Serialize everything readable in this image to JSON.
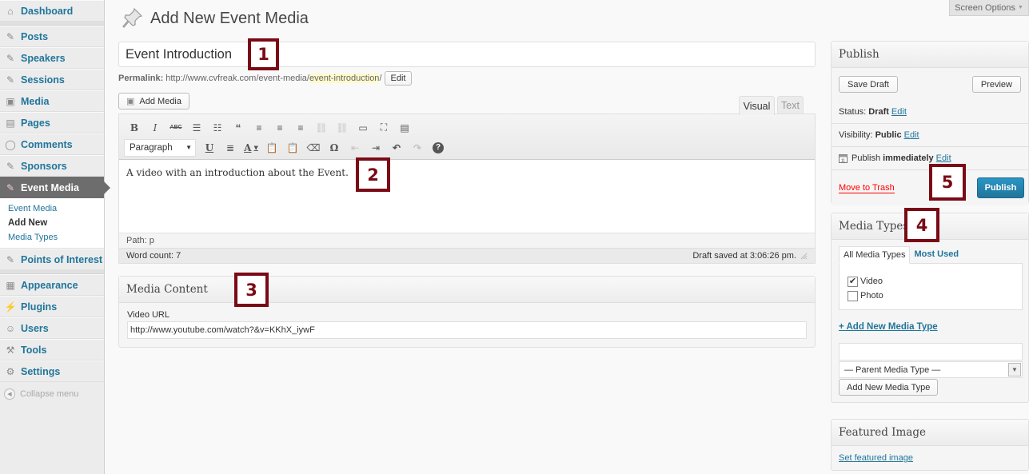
{
  "sidebar": {
    "items": [
      {
        "label": "Dashboard",
        "icon": "dashboard-icon"
      },
      {
        "label": "Posts",
        "icon": "pin-icon"
      },
      {
        "label": "Speakers",
        "icon": "pin-icon"
      },
      {
        "label": "Sessions",
        "icon": "pin-icon"
      },
      {
        "label": "Media",
        "icon": "media-icon"
      },
      {
        "label": "Pages",
        "icon": "pages-icon"
      },
      {
        "label": "Comments",
        "icon": "comment-icon"
      },
      {
        "label": "Sponsors",
        "icon": "pin-icon"
      },
      {
        "label": "Event Media",
        "icon": "pin-icon",
        "current": true
      },
      {
        "label": "Points of Interest",
        "icon": "pin-icon"
      },
      {
        "label": "Appearance",
        "icon": "appearance-icon"
      },
      {
        "label": "Plugins",
        "icon": "plugin-icon"
      },
      {
        "label": "Users",
        "icon": "users-icon"
      },
      {
        "label": "Tools",
        "icon": "tools-icon"
      },
      {
        "label": "Settings",
        "icon": "settings-icon"
      }
    ],
    "submenu": [
      "Event Media",
      "Add New",
      "Media Types"
    ],
    "collapse_label": "Collapse menu"
  },
  "header": {
    "title": "Add New Event Media",
    "screen_options": "Screen Options"
  },
  "post": {
    "title_value": "Event Introduction",
    "permalink_label": "Permalink:",
    "permalink_base": "http://www.cvfreak.com/event-media/",
    "permalink_slug": "event-introduction",
    "permalink_trail": "/",
    "permalink_edit": "Edit",
    "add_media": "Add Media"
  },
  "editor": {
    "tabs": {
      "visual": "Visual",
      "text": "Text"
    },
    "format_value": "Paragraph",
    "content": "A video with an introduction about the Event.",
    "path": "Path: p",
    "word_count": "Word count: 7",
    "draft_saved": "Draft saved at 3:06:26 pm."
  },
  "media_content": {
    "title": "Media Content",
    "field_label": "Video URL",
    "video_url": "http://www.youtube.com/watch?&v=KKhX_iywF"
  },
  "publish": {
    "title": "Publish",
    "save_draft": "Save Draft",
    "preview": "Preview",
    "status_label": "Status:",
    "status_value": "Draft",
    "visibility_label": "Visibility:",
    "visibility_value": "Public",
    "schedule_label": "Publish",
    "schedule_value": "immediately",
    "edit": "Edit",
    "trash": "Move to Trash",
    "publish_button": "Publish"
  },
  "media_types": {
    "title": "Media Types",
    "tabs": [
      "All Media Types",
      "Most Used"
    ],
    "options": [
      {
        "label": "Video",
        "checked": true
      },
      {
        "label": "Photo",
        "checked": false
      }
    ],
    "add_new_link": "+ Add New Media Type",
    "parent_select": "— Parent Media Type —",
    "add_button": "Add New Media Type"
  },
  "featured_image": {
    "title": "Featured Image",
    "link": "Set featured image"
  },
  "annotations": [
    "1",
    "2",
    "3",
    "4",
    "5"
  ],
  "colors": {
    "accent": "#21759b",
    "annotation": "#7a0a16",
    "trash": "#ff0000"
  }
}
